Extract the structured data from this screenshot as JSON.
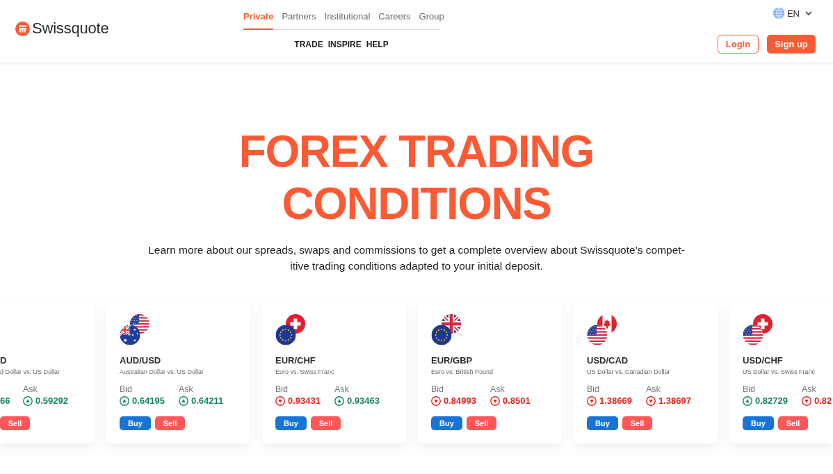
{
  "header": {
    "logo": {
      "name": "Swissquote"
    },
    "nav_tabs": [
      {
        "label": "Private",
        "selected": true
      },
      {
        "label": "Partners",
        "selected": false
      },
      {
        "label": "Institutional",
        "selected": false
      },
      {
        "label": "Careers",
        "selected": false
      },
      {
        "label": "Group",
        "selected": false
      }
    ],
    "nav_sections": [
      "TRADE",
      "INSPIRE",
      "HELP"
    ],
    "language": {
      "label": "EN"
    },
    "buttons": [
      {
        "label": "Login",
        "kind": "outline"
      },
      {
        "label": "Sign up",
        "kind": "filled"
      }
    ]
  },
  "hero": {
    "title": "FOREX TRADING CONDITIONS",
    "description": "Learn more about our spreads, swaps and commissions to get a complete overview about Swissquote’s compet-itive trading conditions adapted to your initial deposit."
  },
  "cards": [
    {
      "pair": "D",
      "description": "d Dollar vs. US Dollar",
      "quotes": [
        {
          "value": "66",
          "rising": true
        },
        {
          "label": "Ask",
          "value": "0.59292",
          "rising": true
        }
      ],
      "buttons": [
        {
          "label": "Sell",
          "kind": "sell"
        }
      ]
    },
    {
      "flags": [
        {
          "kind": "us"
        },
        {
          "kind": "au"
        }
      ],
      "pair": "AUD/USD",
      "description": "Australian Dollar vs. US Dollar",
      "quotes": [
        {
          "label": "Bid",
          "value": "0.64195",
          "rising": true
        },
        {
          "label": "Ask",
          "value": "0.64211",
          "rising": true
        }
      ],
      "buttons": [
        {
          "label": "Buy",
          "kind": "buy"
        },
        {
          "label": "Sell",
          "kind": "sell"
        }
      ]
    },
    {
      "flags": [
        {
          "kind": "ch"
        },
        {
          "kind": "eu"
        }
      ],
      "pair": "EUR/CHF",
      "description": "Euro vs. Swiss Franc",
      "quotes": [
        {
          "label": "Bid",
          "value": "0.93431",
          "rising": false
        },
        {
          "label": "Ask",
          "value": "0.93463",
          "rising": true
        }
      ],
      "buttons": [
        {
          "label": "Buy",
          "kind": "buy"
        },
        {
          "label": "Sell",
          "kind": "sell"
        }
      ]
    },
    {
      "flags": [
        {
          "kind": "gb"
        },
        {
          "kind": "eu"
        }
      ],
      "pair": "EUR/GBP",
      "description": "Euro vs. British Pound",
      "quotes": [
        {
          "label": "Bid",
          "value": "0.84993",
          "rising": false
        },
        {
          "label": "Ask",
          "value": "0.8501",
          "rising": false
        }
      ],
      "buttons": [
        {
          "label": "Buy",
          "kind": "buy"
        },
        {
          "label": "Sell",
          "kind": "sell"
        }
      ]
    },
    {
      "flags": [
        {
          "kind": "ca"
        },
        {
          "kind": "us"
        }
      ],
      "pair": "USD/CAD",
      "description": "US Dollar vs. Canadian Dollar",
      "quotes": [
        {
          "label": "Bid",
          "value": "1.38669",
          "rising": false
        },
        {
          "label": "Ask",
          "value": "1.38697",
          "rising": false
        }
      ],
      "buttons": [
        {
          "label": "Buy",
          "kind": "buy"
        },
        {
          "label": "Sell",
          "kind": "sell"
        }
      ]
    },
    {
      "flags": [
        {
          "kind": "ch"
        },
        {
          "kind": "us"
        }
      ],
      "pair": "USD/CHF",
      "description": "US Dollar vs. Swiss Franc",
      "quotes": [
        {
          "label": "Bid",
          "value": "0.82729",
          "rising": true
        },
        {
          "label": "Ask",
          "value": "0.82",
          "rising": false
        }
      ],
      "buttons": [
        {
          "label": "Buy",
          "kind": "buy"
        },
        {
          "label": "Sell",
          "kind": "sell"
        }
      ]
    }
  ]
}
